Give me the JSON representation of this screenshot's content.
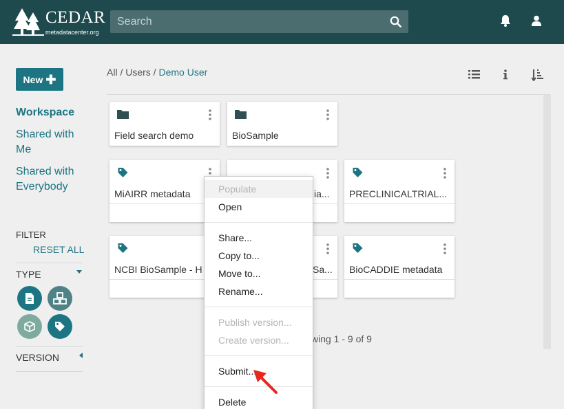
{
  "header": {
    "logo_title": "CEDAR",
    "logo_subtitle": "metadatacenter.org",
    "search_placeholder": "Search",
    "search_icon": "search-icon",
    "notifications_icon": "bell-icon",
    "user_icon": "user-icon"
  },
  "sidebar": {
    "new_label": "New",
    "nav": {
      "workspace": "Workspace",
      "shared_me": "Shared with Me",
      "shared_everybody": "Shared with Everybody"
    },
    "filter_label": "FILTER",
    "reset_all": "RESET ALL",
    "type_label": "TYPE",
    "type_filters": [
      {
        "icon": "template-icon",
        "selected": true
      },
      {
        "icon": "element-icon",
        "selected": false
      },
      {
        "icon": "field-icon",
        "selected": false
      },
      {
        "icon": "instance-icon",
        "selected": true
      }
    ],
    "version_label": "VERSION"
  },
  "breadcrumb": {
    "all": "All",
    "sep1": " / ",
    "users": "Users",
    "sep2": " / ",
    "current": "Demo User"
  },
  "toolbar": {
    "view_icon": "list-view-icon",
    "info_icon": "info-icon",
    "sort_icon": "sort-icon"
  },
  "resources": [
    {
      "title": "Field search demo",
      "type": "folder"
    },
    {
      "title": "BioSample",
      "type": "folder"
    },
    {
      "title": "MiAIRR metadata",
      "type": "instance"
    },
    {
      "title": "ia...",
      "type": "instance"
    },
    {
      "title": "PRECLINICALTRIAL...",
      "type": "instance"
    },
    {
      "title": "NCBI BioSample - H",
      "type": "instance"
    },
    {
      "title": "Sa...",
      "type": "instance"
    },
    {
      "title": "BioCADDIE metadata",
      "type": "instance"
    }
  ],
  "pagination": "wing 1 - 9 of 9",
  "context_menu": {
    "populate": "Populate",
    "open": "Open",
    "share": "Share...",
    "copy": "Copy to...",
    "move": "Move to...",
    "rename": "Rename...",
    "publish": "Publish version...",
    "create_version": "Create version...",
    "submit": "Submit...",
    "delete": "Delete"
  },
  "colors": {
    "header": "#1e4a4d",
    "accent": "#1d7583",
    "pointer": "#e8271f"
  }
}
